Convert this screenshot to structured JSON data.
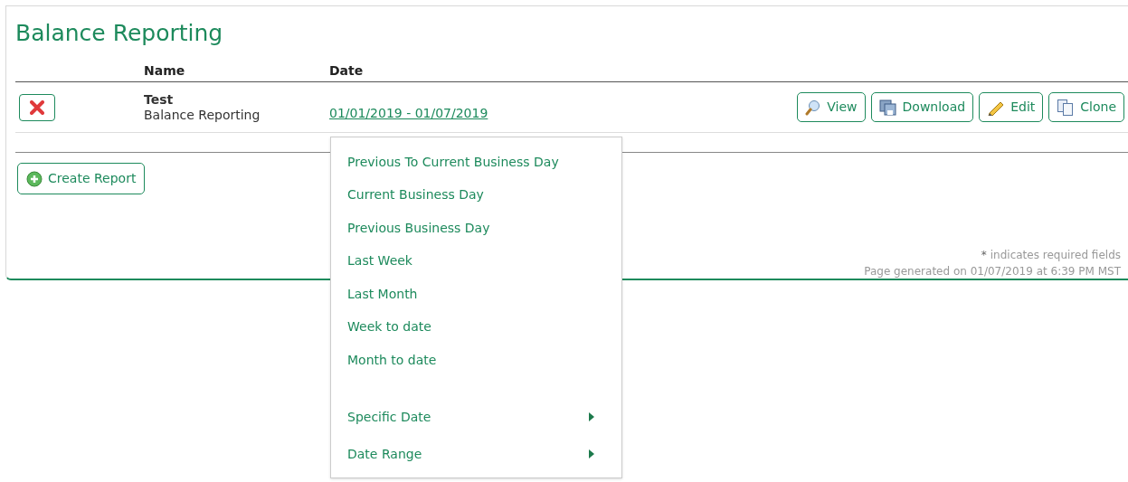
{
  "title": "Balance Reporting",
  "table": {
    "columns": [
      "Name",
      "Date"
    ],
    "rows": [
      {
        "name": "Test",
        "subtitle": "Balance Reporting",
        "date": "01/01/2019 - 01/07/2019",
        "actions": [
          {
            "kind": "view",
            "label": "View"
          },
          {
            "kind": "download",
            "label": "Download"
          },
          {
            "kind": "edit",
            "label": "Edit"
          },
          {
            "kind": "clone",
            "label": "Clone"
          }
        ]
      }
    ]
  },
  "create_button": "Create Report",
  "footer": {
    "required_mark": "*",
    "required_note": "indicates required fields",
    "generated": "Page generated on 01/07/2019 at 6:39 PM MST"
  },
  "date_menu": [
    {
      "label": "Previous To Current Business Day",
      "kind": "option"
    },
    {
      "label": "Current Business Day",
      "kind": "option"
    },
    {
      "label": "Previous Business Day",
      "kind": "option"
    },
    {
      "label": "Last Week",
      "kind": "option"
    },
    {
      "label": "Last Month",
      "kind": "option"
    },
    {
      "label": "Week to date",
      "kind": "option"
    },
    {
      "label": "Month to date",
      "kind": "option"
    },
    {
      "label": "Specific Date",
      "kind": "submenu"
    },
    {
      "label": "Date Range",
      "kind": "submenu"
    }
  ]
}
